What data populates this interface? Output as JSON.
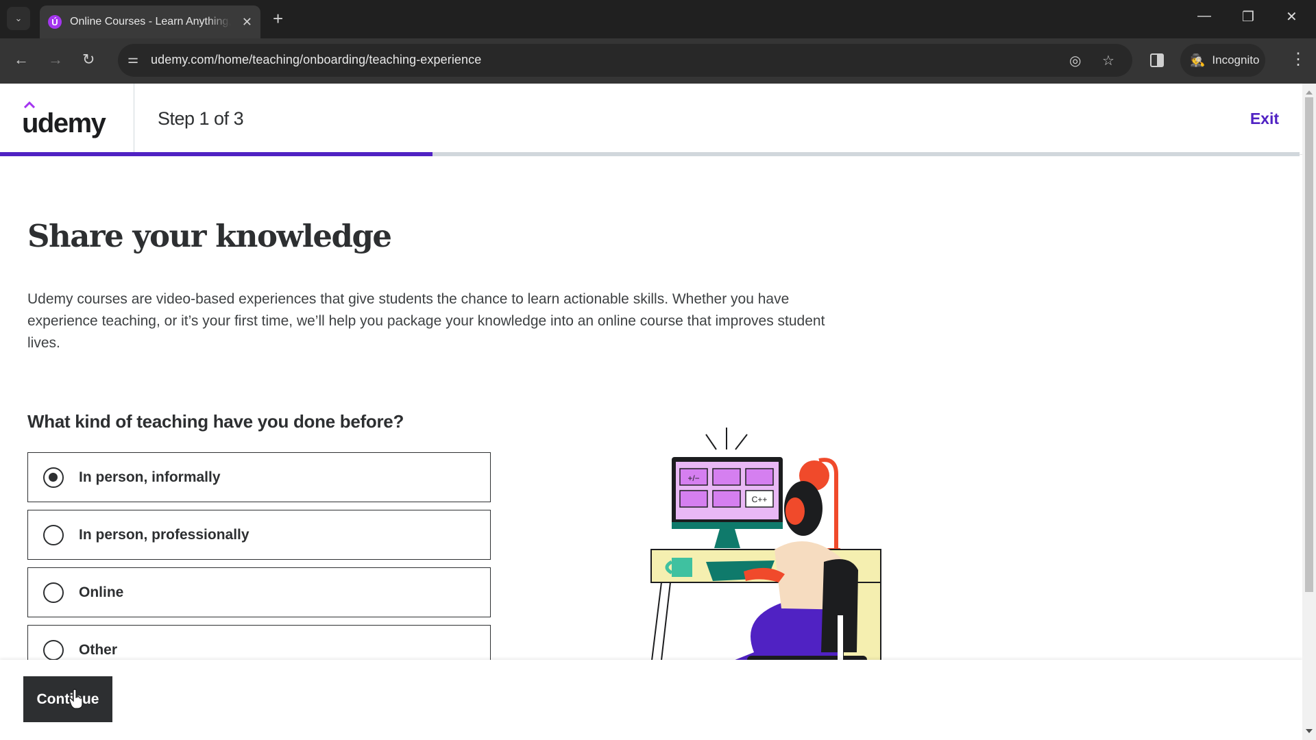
{
  "browser": {
    "tab_title": "Online Courses - Learn Anything, On Your Schedule | Udemy",
    "tab_favicon": "Ú",
    "url": "udemy.com/home/teaching/onboarding/teaching-experience",
    "incognito_label": "Incognito",
    "icons": {
      "tab_search": "⌄",
      "tab_close": "✕",
      "new_tab": "+",
      "minimize": "—",
      "restore": "❐",
      "close": "✕",
      "back": "←",
      "forward": "→",
      "reload": "↻",
      "site_info": "⚌",
      "eye_off": "◎",
      "star": "☆",
      "incognito": "🕵",
      "menu": "⋮"
    }
  },
  "header": {
    "logo": "udemy",
    "step": "Step 1 of 3",
    "exit_label": "Exit",
    "progress": 0.333,
    "accent_color": "#5022c3"
  },
  "main": {
    "title": "Share your knowledge",
    "description": "Udemy courses are video-based experiences that give students the chance to learn actionable skills. Whether you have experience teaching, or it’s your first time, we’ll help you package your knowledge into an online course that improves student lives.",
    "question": "What kind of teaching have you done before?",
    "options": [
      {
        "label": "In person, informally",
        "selected": true
      },
      {
        "label": "In person, professionally",
        "selected": false
      },
      {
        "label": "Online",
        "selected": false
      },
      {
        "label": "Other",
        "selected": false
      }
    ],
    "illustration_screen_labels": [
      "+/−",
      "C++"
    ]
  },
  "footer": {
    "continue_label": "Continue"
  }
}
